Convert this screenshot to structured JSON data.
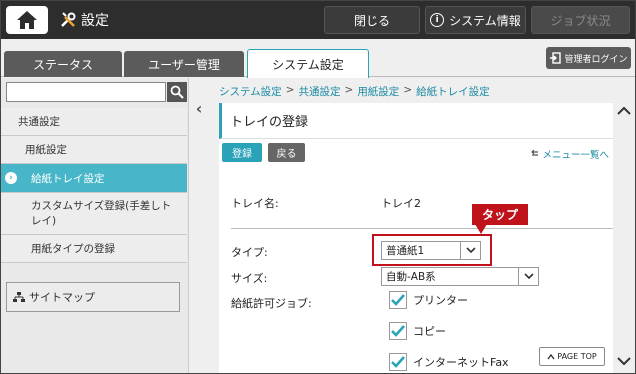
{
  "topbar": {
    "title": "設定",
    "close_label": "閉じる",
    "sysinfo_label": "システム情報",
    "job_label": "ジョブ状況",
    "icons": {
      "home": "home-icon",
      "settings": "wrench-screwdriver-icon",
      "info": "info-icon"
    }
  },
  "tabs": {
    "status": "ステータス",
    "user": "ユーザー管理",
    "system": "システム設定",
    "admin_login": "管理者ログイン"
  },
  "sidebar": {
    "search_value": "",
    "items": [
      {
        "label": "共通設定"
      },
      {
        "label": "用紙設定"
      },
      {
        "label": "給紙トレイ設定"
      },
      {
        "label": "カスタムサイズ登録(手差しトレイ)"
      },
      {
        "label": "用紙タイプの登録"
      }
    ],
    "sitemap": "サイトマップ"
  },
  "breadcrumb": [
    "システム設定",
    "共通設定",
    "用紙設定",
    "給紙トレイ設定"
  ],
  "breadcrumb_sep": ">",
  "panel": {
    "title": "トレイの登録",
    "register_label": "登録",
    "back_label": "戻る",
    "menu_link": "メニュー一覧へ",
    "tray_name_label": "トレイ名:",
    "tray_name_value": "トレイ2",
    "type_label": "タイプ:",
    "type_value": "普通紙1",
    "size_label": "サイズ:",
    "size_value": "自動-AB系",
    "jobs_label": "給紙許可ジョブ:",
    "jobs": [
      {
        "label": "プリンター",
        "checked": true
      },
      {
        "label": "コピー",
        "checked": true
      },
      {
        "label": "インターネットFax",
        "checked": true
      }
    ]
  },
  "annotation": {
    "tap_label": "タップ",
    "color": "#c0121b"
  },
  "pagetop_label": "PAGE TOP",
  "colors": {
    "accent": "#2aa2b8",
    "selected_item": "#47b6c9",
    "topbar": "#2d2d2d"
  }
}
